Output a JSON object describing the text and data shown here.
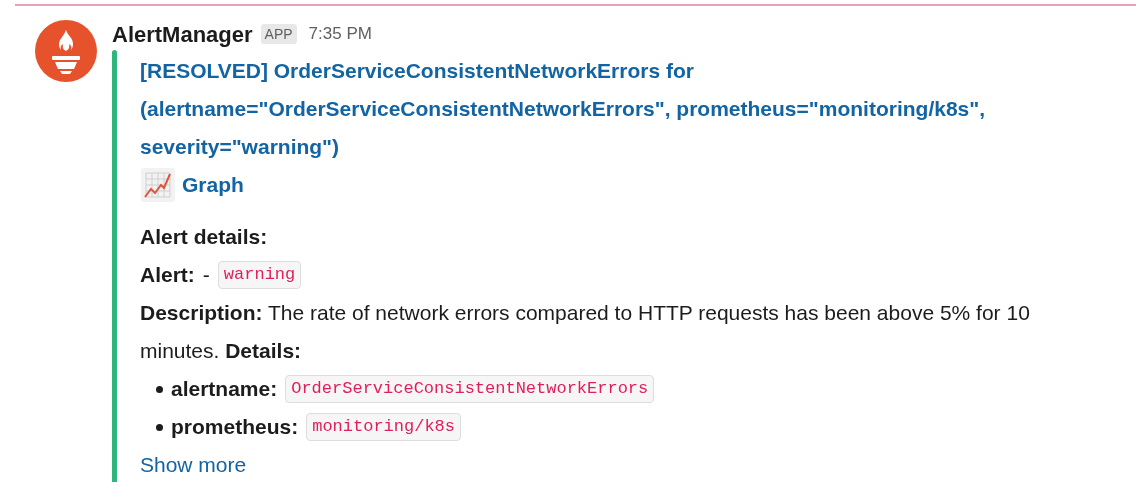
{
  "message": {
    "sender": "AlertManager",
    "badge": "APP",
    "time": "7:35 PM",
    "attachment": {
      "color": "#2eb67d",
      "title": "[RESOLVED] OrderServiceConsistentNetworkErrors for (alertname=\"OrderServiceConsistentNetworkErrors\", prometheus=\"monitoring/k8s\", severity=\"warning\")",
      "graph_link": "Graph",
      "details_heading": "Alert details:",
      "alert_label": "Alert:",
      "alert_separator": "-",
      "alert_value": "warning",
      "description": "**Description:** The rate of network errors compared to HTTP requests has been above 5% for 10 minutes. **Details:**",
      "labels": [
        {
          "key": "alertname:",
          "value": "OrderServiceConsistentNetworkErrors"
        },
        {
          "key": "prometheus:",
          "value": "monitoring/k8s"
        }
      ],
      "show_more": "Show more"
    }
  }
}
